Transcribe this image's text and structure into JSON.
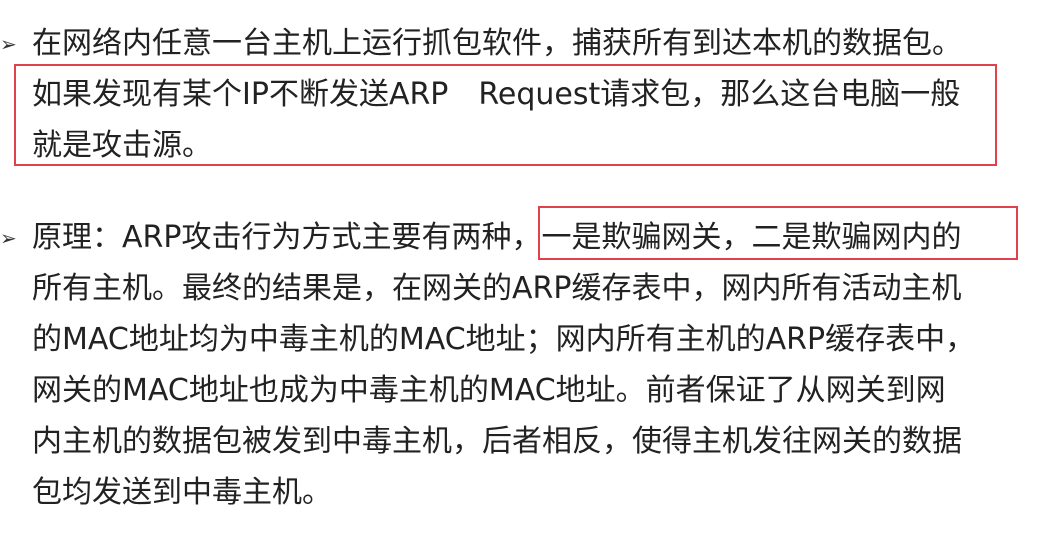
{
  "bullets": {
    "first": {
      "lines": [
        "在网络内任意一台主机上运行抓包软件，捕获所有到达本机的数据包。",
        "如果发现有某个IP不断发送ARP　Request请求包，那么这台电脑一般",
        "就是攻击源。"
      ]
    },
    "second": {
      "lines": [
        "原理：ARP攻击行为方式主要有两种，一是欺骗网关，二是欺骗网内的",
        "所有主机。最终的结果是，在网关的ARP缓存表中，网内所有活动主机",
        "的MAC地址均为中毒主机的MAC地址；网内所有主机的ARP缓存表中，",
        "网关的MAC地址也成为中毒主机的MAC地址。前者保证了从网关到网",
        "内主机的数据包被发到中毒主机，后者相反，使得主机发往网关的数据",
        "包均发送到中毒主机。"
      ]
    }
  },
  "colors": {
    "highlight_box": "#e0414b",
    "text": "#222222"
  }
}
